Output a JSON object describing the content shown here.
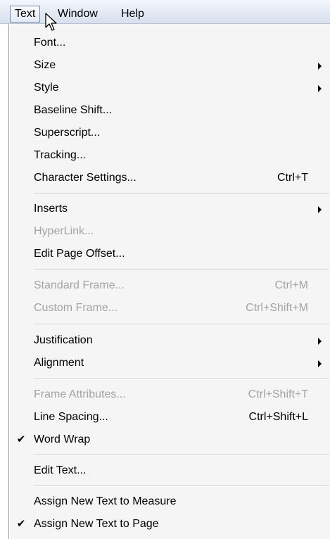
{
  "menubar": {
    "items": [
      {
        "label": "Text",
        "active": true
      },
      {
        "label": "Window",
        "active": false
      },
      {
        "label": "Help",
        "active": false
      }
    ]
  },
  "menu": {
    "font": {
      "label": "Font..."
    },
    "size": {
      "label": "Size",
      "submenu": true
    },
    "style": {
      "label": "Style",
      "submenu": true
    },
    "baseline_shift": {
      "label": "Baseline Shift..."
    },
    "superscript": {
      "label": "Superscript..."
    },
    "tracking": {
      "label": "Tracking..."
    },
    "character_settings": {
      "label": "Character Settings...",
      "shortcut": "Ctrl+T"
    },
    "inserts": {
      "label": "Inserts",
      "submenu": true
    },
    "hyperlink": {
      "label": "HyperLink...",
      "disabled": true
    },
    "edit_page_offset": {
      "label": "Edit Page Offset..."
    },
    "standard_frame": {
      "label": "Standard Frame...",
      "shortcut": "Ctrl+M",
      "disabled": true
    },
    "custom_frame": {
      "label": "Custom Frame...",
      "shortcut": "Ctrl+Shift+M",
      "disabled": true
    },
    "justification": {
      "label": "Justification",
      "submenu": true
    },
    "alignment": {
      "label": "Alignment",
      "submenu": true
    },
    "frame_attributes": {
      "label": "Frame Attributes...",
      "shortcut": "Ctrl+Shift+T",
      "disabled": true
    },
    "line_spacing": {
      "label": "Line Spacing...",
      "shortcut": "Ctrl+Shift+L"
    },
    "word_wrap": {
      "label": "Word Wrap",
      "checked": true
    },
    "edit_text": {
      "label": "Edit Text..."
    },
    "assign_measure": {
      "label": "Assign New Text to Measure"
    },
    "assign_page": {
      "label": "Assign New Text to Page",
      "checked": true
    }
  },
  "colors": {
    "menu_bg": "#f5f5f5",
    "disabled_text": "#a3a3a3",
    "menubar_bg": "#e6ecf5"
  },
  "icons": {
    "check": "✔",
    "submenu_arrow": "chevron-right-icon",
    "cursor": "mouse-pointer-icon"
  }
}
